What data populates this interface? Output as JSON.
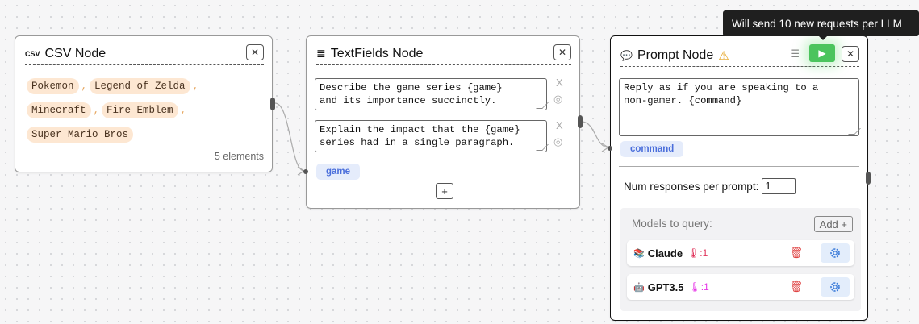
{
  "csv_node": {
    "icon_text": "CSV",
    "title": "CSV Node",
    "close": "✕",
    "items": [
      "Pokemon",
      "Legend of Zelda",
      "Minecraft",
      "Fire Emblem",
      "Super Mario Bros"
    ],
    "separator": ",",
    "count_text": "5 elements"
  },
  "textfields_node": {
    "icon": "≣",
    "title": "TextFields Node",
    "close": "✕",
    "fields": [
      {
        "value": "Describe the game series {game}\nand its importance succinctly.",
        "remove": "X",
        "eye": "◎"
      },
      {
        "value": "Explain the impact that the {game}\nseries had in a single paragraph.",
        "remove": "X",
        "eye": "◎"
      }
    ],
    "var_tag": "game",
    "add_label": "+"
  },
  "prompt_node": {
    "icon": "💬",
    "title": "Prompt Node",
    "warning_icon": "⚠",
    "list_icon": "☰",
    "run_icon": "▶",
    "close": "✕",
    "prompt_text": "Reply as if you are speaking to a\nnon-gamer. {command}",
    "var_tag": "command",
    "num_label": "Num responses per prompt:",
    "num_value": "1",
    "models_label": "Models to query:",
    "add_label": "Add +",
    "models": [
      {
        "emoji": "📚",
        "name": "Claude",
        "temp": "🌡:1",
        "trash": "🗑",
        "gear": "⚙"
      },
      {
        "emoji": "🤖",
        "name": "GPT3.5",
        "temp": "🌡:1",
        "trash": "🗑",
        "gear": "⚙"
      }
    ]
  },
  "tooltip": {
    "text": "Will send 10 new requests per LLM"
  },
  "colors": {
    "chip_bg": "#fde7d2",
    "tag_bg": "#e5ecfb",
    "tag_text": "#4a6edb",
    "run_green": "#4bc45d",
    "trash_red": "#e04646",
    "gear_blue": "#3b7bd9"
  }
}
